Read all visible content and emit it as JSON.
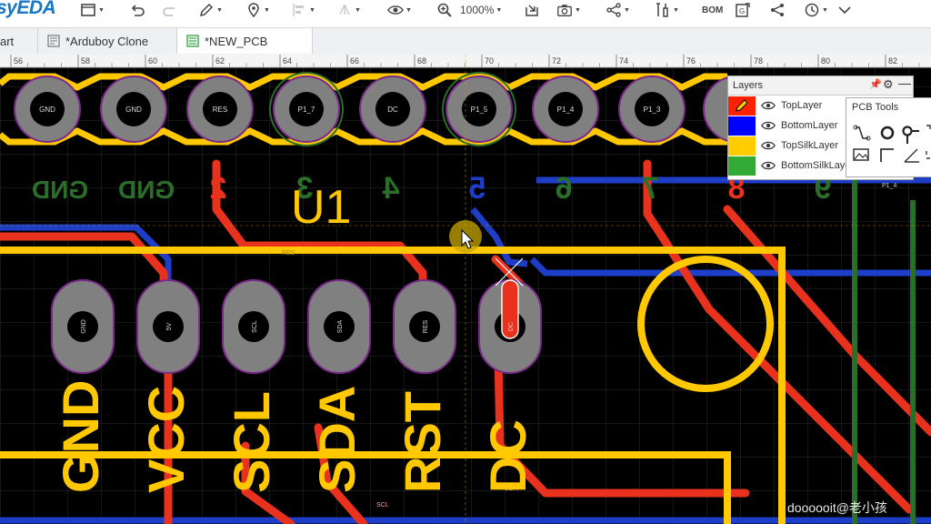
{
  "app": {
    "logo": "syEDA"
  },
  "toolbar": {
    "zoom": "1000%",
    "bom_label": "BOM",
    "icons": [
      "file-icon",
      "undo-icon",
      "redo-icon",
      "pencil-icon",
      "pin-icon",
      "align-icon",
      "tree-icon",
      "eye-icon",
      "zoom-icon",
      "import-icon",
      "camera-icon",
      "share-icon",
      "tools-icon",
      "bom-icon",
      "gerber-icon",
      "link-icon",
      "history-icon",
      "chevron-down-icon"
    ]
  },
  "tabs": [
    {
      "label": "art"
    },
    {
      "label": "*Arduboy Clone"
    },
    {
      "label": "*NEW_PCB",
      "active": true
    }
  ],
  "ruler": {
    "ticks": [
      "56",
      "58",
      "60",
      "62",
      "64",
      "66",
      "68",
      "70",
      "72",
      "74",
      "76",
      "78",
      "80",
      "82"
    ]
  },
  "header_pins": [
    "GND",
    "GND",
    "RES",
    "P1_7",
    "DC",
    "P1_5",
    "P1_4",
    "P1_3"
  ],
  "pin_numbers": [
    "GND",
    "GND",
    "2",
    "3",
    "4",
    "5",
    "6",
    "7",
    "8",
    "9"
  ],
  "component_ref": "U1",
  "oval_pads": [
    "GND",
    "5V",
    "SCL",
    "SDA",
    "RES",
    "DC"
  ],
  "pin_labels": [
    "GND",
    "VCC",
    "SCL",
    "SDA",
    "RST",
    "DC"
  ],
  "net_labels": {
    "res": "RES",
    "scl": "SCL",
    "sda": "SDA",
    "p1_4": "P1_4"
  },
  "layers_panel": {
    "title": "Layers",
    "layers": [
      {
        "name": "TopLayer",
        "color": "#ff2200"
      },
      {
        "name": "BottomLayer",
        "color": "#0000ff"
      },
      {
        "name": "TopSilkLayer",
        "color": "#ffcc00"
      },
      {
        "name": "BottomSilkLayer",
        "color": "#33aa33"
      }
    ]
  },
  "pcb_tools": {
    "title": "PCB Tools"
  },
  "colors": {
    "board_bg": "#000000",
    "top_layer": "#e8321e",
    "bottom_layer": "#1e3ec8",
    "top_silk": "#ffc800",
    "bottom_silk": "#2a6e2a",
    "pad": "#808080",
    "grid": "#2b2b2b"
  },
  "watermark": "doooooit@老小孩"
}
